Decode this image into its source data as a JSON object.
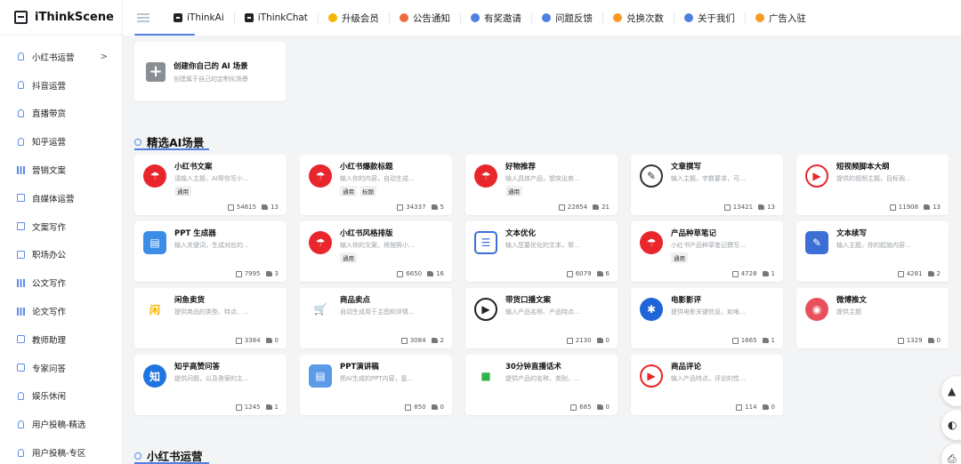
{
  "app": {
    "name": "iThinkScene"
  },
  "nav": {
    "items": [
      {
        "label": "iThinkAi",
        "icon": "square-logo-icon",
        "color": "#222222"
      },
      {
        "label": "iThinkChat",
        "icon": "square-logo-icon",
        "color": "#222222"
      },
      {
        "label": "升级会员",
        "icon": "coin-icon",
        "color": "#f5b400"
      },
      {
        "label": "公告通知",
        "icon": "speaker-icon",
        "color": "#ef6b3a"
      },
      {
        "label": "有奖邀请",
        "icon": "gift-icon",
        "color": "#4f7fe0"
      },
      {
        "label": "问题反馈",
        "icon": "question-icon",
        "color": "#4f7fe0"
      },
      {
        "label": "兑换次数",
        "icon": "exchange-icon",
        "color": "#f59a23"
      },
      {
        "label": "关于我们",
        "icon": "info-icon",
        "color": "#4f7fe0"
      },
      {
        "label": "广告入驻",
        "icon": "ad-icon",
        "color": "#f59a23"
      }
    ]
  },
  "sidebar": {
    "items": [
      {
        "label": "小红书运营",
        "icon": "bulb",
        "arrow": ">"
      },
      {
        "label": "抖音运营",
        "icon": "bulb"
      },
      {
        "label": "直播带货",
        "icon": "bulb"
      },
      {
        "label": "知乎运营",
        "icon": "bulb"
      },
      {
        "label": "营销文案",
        "icon": "bars"
      },
      {
        "label": "自媒体运营",
        "icon": "box"
      },
      {
        "label": "文案写作",
        "icon": "box"
      },
      {
        "label": "职场办公",
        "icon": "box"
      },
      {
        "label": "公文写作",
        "icon": "bars"
      },
      {
        "label": "论文写作",
        "icon": "bars"
      },
      {
        "label": "教师助理",
        "icon": "person"
      },
      {
        "label": "专家问答",
        "icon": "person"
      },
      {
        "label": "娱乐休闲",
        "icon": "bulb"
      },
      {
        "label": "用户投稿-精选",
        "icon": "bulb"
      },
      {
        "label": "用户投稿-专区",
        "icon": "bulb"
      }
    ]
  },
  "create_card": {
    "plus": "+",
    "title": "创建你自己的 AI 场景",
    "desc": "创建属于自己的定制化场景"
  },
  "sections": {
    "featured": "精选AI场景",
    "xiaohongshu": "小红书运营"
  },
  "cards": [
    {
      "title": "小红书文案",
      "desc": "请输入主题，AI帮你写小...",
      "tags": [
        "通用"
      ],
      "uses": "54615",
      "likes": "13",
      "icon": "umbrella-icon",
      "glyph": "☂",
      "color": "#e8262c"
    },
    {
      "title": "小红书爆款标题",
      "desc": "输入你的内容，自动生成...",
      "tags": [
        "通用",
        "标题"
      ],
      "uses": "34337",
      "likes": "5",
      "icon": "umbrella-icon",
      "glyph": "☂",
      "color": "#e8262c"
    },
    {
      "title": "好物推荐",
      "desc": "输入具体产品，想突出卖...",
      "tags": [
        "通用"
      ],
      "uses": "22854",
      "likes": "21",
      "icon": "umbrella-icon",
      "glyph": "☂",
      "color": "#e8262c"
    },
    {
      "title": "文章撰写",
      "desc": "输入主题，字数要求，可...",
      "tags": [],
      "uses": "13421",
      "likes": "13",
      "icon": "document-edit-icon",
      "glyph": "✎",
      "color": "#ffffff",
      "fg": "#333333",
      "border": "#333333"
    },
    {
      "title": "短视频脚本大纲",
      "desc": "提供的视频主题，目标观...",
      "tags": [],
      "uses": "11908",
      "likes": "13",
      "icon": "play-icon",
      "glyph": "▶",
      "color": "#ffffff",
      "fg": "#e8262c",
      "border": "#e8262c"
    },
    {
      "title": "PPT 生成器",
      "desc": "输入关键词，生成对应的...",
      "tags": [],
      "uses": "7995",
      "likes": "3",
      "icon": "presentation-icon",
      "glyph": "▤",
      "color": "#3b8de8",
      "square": true
    },
    {
      "title": "小红书风格排版",
      "desc": "输入你的文案，将按照小...",
      "tags": [
        "通用"
      ],
      "uses": "6650",
      "likes": "16",
      "icon": "umbrella-icon",
      "glyph": "☂",
      "color": "#e8262c"
    },
    {
      "title": "文本优化",
      "desc": "输入您要优化的文本，帮...",
      "tags": [],
      "uses": "6079",
      "likes": "6",
      "icon": "list-icon",
      "glyph": "☰",
      "color": "#ffffff",
      "fg": "#3b6fd6",
      "border": "#3b6fd6",
      "square": true
    },
    {
      "title": "产品种草笔记",
      "desc": "小红书产品种草笔记撰写...",
      "tags": [
        "通用"
      ],
      "uses": "4728",
      "likes": "1",
      "icon": "umbrella-icon",
      "glyph": "☂",
      "color": "#e8262c"
    },
    {
      "title": "文本续写",
      "desc": "输入主题，你的起始内容...",
      "tags": [],
      "uses": "4281",
      "likes": "2",
      "icon": "pen-icon",
      "glyph": "✎",
      "color": "#3b6fd6",
      "square": true
    },
    {
      "title": "闲鱼卖货",
      "desc": "提供商品的类型、特点、...",
      "tags": [],
      "uses": "3384",
      "likes": "0",
      "icon": "xianyu-icon",
      "glyph": "闲",
      "color": "#ffffff",
      "fg": "#f5b400",
      "square": true
    },
    {
      "title": "商品卖点",
      "desc": "自动生成用于主图和详情...",
      "tags": [],
      "uses": "3084",
      "likes": "2",
      "icon": "cart-icon",
      "glyph": "🛒",
      "color": "#ffffff",
      "fg": "#f06a2a"
    },
    {
      "title": "带货口播文案",
      "desc": "输入产品名称、产品特点...",
      "tags": [],
      "uses": "2130",
      "likes": "0",
      "icon": "play-icon",
      "glyph": "▶",
      "color": "#ffffff",
      "fg": "#222222",
      "border": "#222222"
    },
    {
      "title": "电影影评",
      "desc": "提供电影关键信息，如电...",
      "tags": [],
      "uses": "1665",
      "likes": "1",
      "icon": "film-reel-icon",
      "glyph": "✱",
      "color": "#1f64d8"
    },
    {
      "title": "微博推文",
      "desc": "提供主题",
      "tags": [],
      "uses": "1329",
      "likes": "0",
      "icon": "weibo-icon",
      "glyph": "◉",
      "color": "#e8505b"
    },
    {
      "title": "知乎高赞问答",
      "desc": "提供问题，以及答案的主...",
      "tags": [],
      "uses": "1245",
      "likes": "1",
      "icon": "zhihu-icon",
      "glyph": "知",
      "color": "#1f74e0"
    },
    {
      "title": "PPT演讲稿",
      "desc": "把AI生成的PPT内容，复...",
      "tags": [],
      "uses": "850",
      "likes": "0",
      "icon": "presentation-icon",
      "glyph": "▤",
      "color": "#5a9be8",
      "square": true
    },
    {
      "title": "30分钟直播话术",
      "desc": "提供产品的名称、类别、...",
      "tags": [],
      "uses": "685",
      "likes": "0",
      "icon": "video-camera-icon",
      "glyph": "■",
      "color": "#ffffff",
      "fg": "#2fb34a",
      "square": true
    },
    {
      "title": "商品评论",
      "desc": "输入产品特点，评论的性...",
      "tags": [],
      "uses": "114",
      "likes": "0",
      "icon": "play-icon",
      "glyph": "▶",
      "color": "#ffffff",
      "fg": "#e8262c",
      "border": "#e8262c"
    }
  ],
  "float_buttons": [
    {
      "glyph": "▲",
      "icon": "scroll-top-icon"
    },
    {
      "glyph": "◐",
      "icon": "support-icon"
    },
    {
      "glyph": "⎙",
      "icon": "feedback-icon"
    }
  ]
}
